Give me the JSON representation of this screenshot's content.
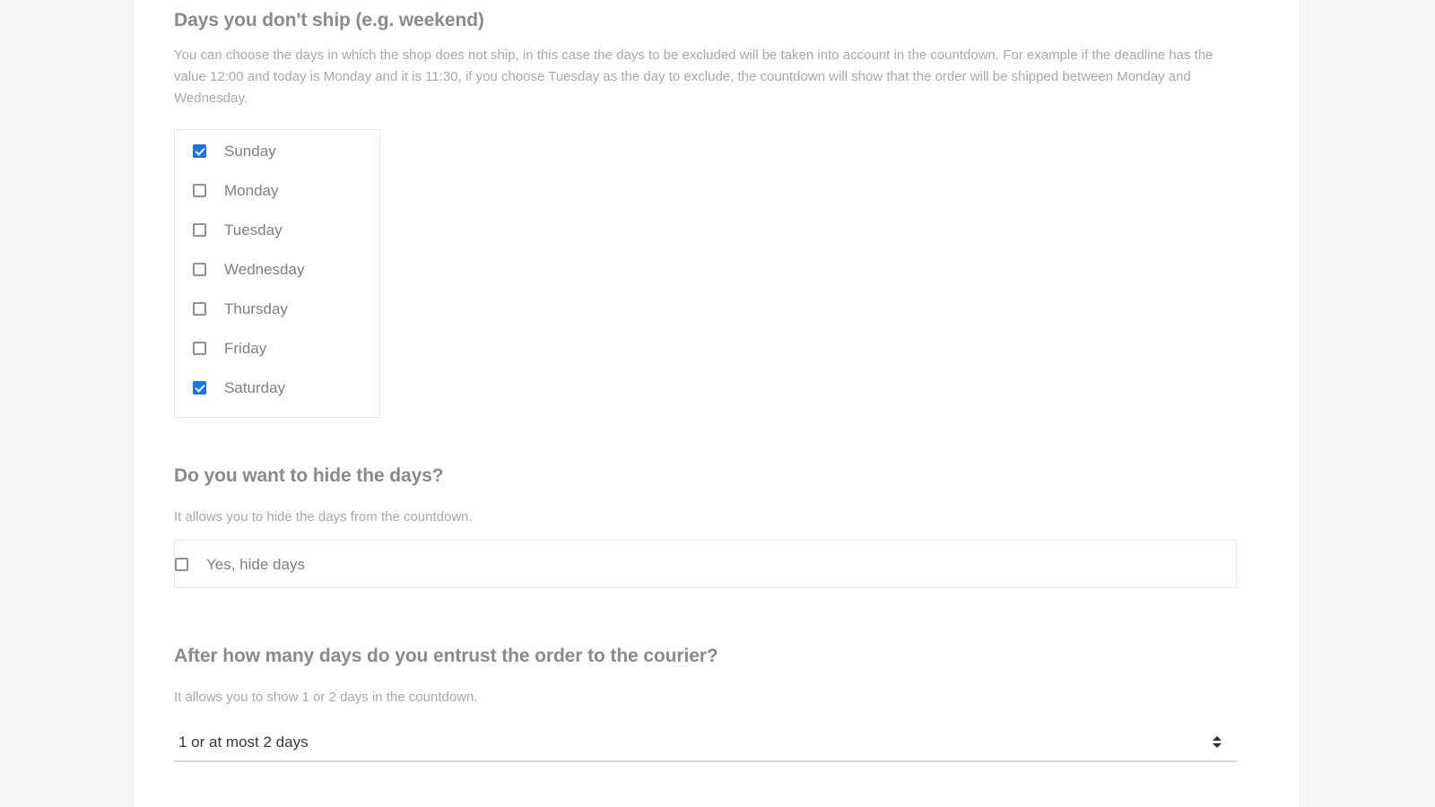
{
  "theme": {
    "page_bg": "#f4f4f5",
    "card_bg": "#ffffff",
    "heading_color": "#888a8c",
    "description_color": "#a6a8ab",
    "label_color": "#7e8083",
    "accent_checkbox": "#1a73f0",
    "border_color": "#e6e6e7",
    "select_value_color": "#35393d"
  },
  "sections": {
    "days_no_ship": {
      "title": "Days you don't ship (e.g. weekend)",
      "description": "You can choose the days in which the shop does not ship, in this case the days to be excluded will be taken into account in the countdown. For example if the deadline has the value 12:00 and today is Monday and it is 11:30, if you choose Tuesday as the day to exclude, the countdown will show that the order will be shipped between Monday and Wednesday.",
      "options": [
        {
          "label": "Sunday",
          "checked": true
        },
        {
          "label": "Monday",
          "checked": false
        },
        {
          "label": "Tuesday",
          "checked": false
        },
        {
          "label": "Wednesday",
          "checked": false
        },
        {
          "label": "Thursday",
          "checked": false
        },
        {
          "label": "Friday",
          "checked": false
        },
        {
          "label": "Saturday",
          "checked": true
        }
      ]
    },
    "hide_days": {
      "title": "Do you want to hide the days?",
      "description": "It allows you to hide the days from the countdown.",
      "option": {
        "label": "Yes, hide days",
        "checked": false
      }
    },
    "courier_days": {
      "title": "After how many days do you entrust the order to the courier?",
      "description": "It allows you to show 1 or 2 days in the countdown.",
      "select": {
        "value": "1 or at most 2 days",
        "icon": "select-chevrons-icon"
      }
    }
  }
}
